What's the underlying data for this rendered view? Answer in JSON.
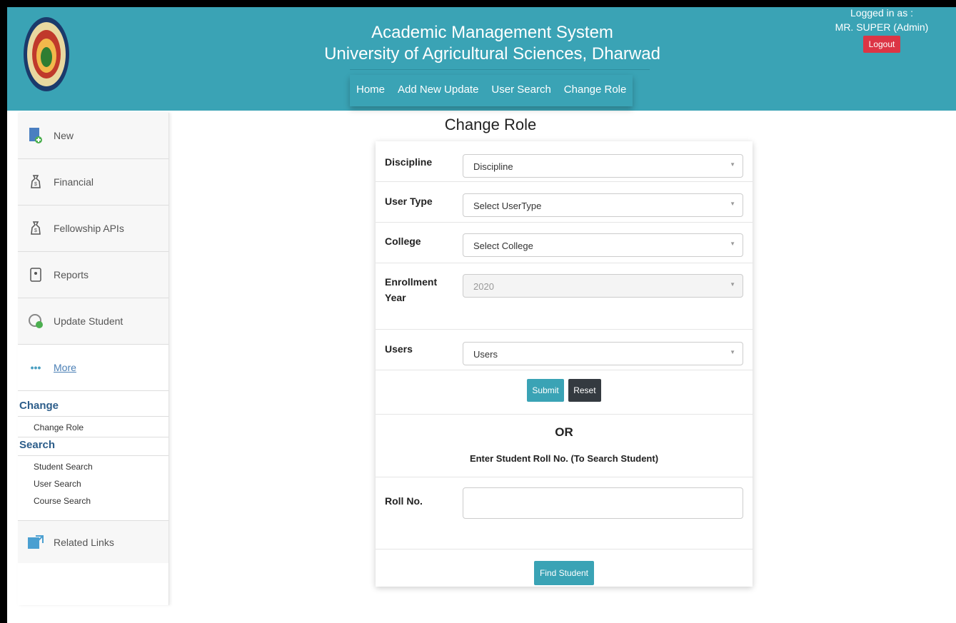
{
  "header": {
    "title_line1": "Academic Management System",
    "title_line2": "University of Agricultural Sciences, Dharwad",
    "nav": [
      "Home",
      "Add New Update",
      "User Search",
      "Change Role"
    ],
    "logged_in_label": "Logged in as :",
    "logged_in_user": "MR. SUPER (Admin)",
    "logout_label": "Logout",
    "accent_color": "#3aa3b5",
    "logout_color": "#dc3545"
  },
  "sidebar": {
    "items": [
      {
        "label": "New",
        "icon": "document-add-icon"
      },
      {
        "label": "Financial",
        "icon": "money-bag-icon"
      },
      {
        "label": "Fellowship APIs",
        "icon": "money-bag-icon"
      },
      {
        "label": "Reports",
        "icon": "report-icon"
      },
      {
        "label": "Update Student",
        "icon": "refresh-icon"
      },
      {
        "label": "More",
        "icon": "ellipsis-icon"
      }
    ],
    "change_heading": "Change",
    "change_links": [
      "Change Role"
    ],
    "search_heading": "Search",
    "search_links": [
      "Student Search",
      "User Search",
      "Course Search"
    ],
    "related_links": "Related Links"
  },
  "page": {
    "title": "Change Role"
  },
  "form": {
    "discipline_label": "Discipline",
    "discipline_value": "Discipline",
    "usertype_label": "User Type",
    "usertype_value": "Select UserType",
    "college_label": "College",
    "college_value": "Select College",
    "enrollment_label_line1": "Enrollment",
    "enrollment_label_line2": "Year",
    "enrollment_value": "2020",
    "users_label": "Users",
    "users_value": "Users",
    "submit_label": "Submit",
    "reset_label": "Reset",
    "or_text": "OR",
    "enter_text": "Enter Student Roll No. (To Search Student)",
    "rollno_label": "Roll No.",
    "rollno_value": "",
    "find_label": "Find Student"
  }
}
